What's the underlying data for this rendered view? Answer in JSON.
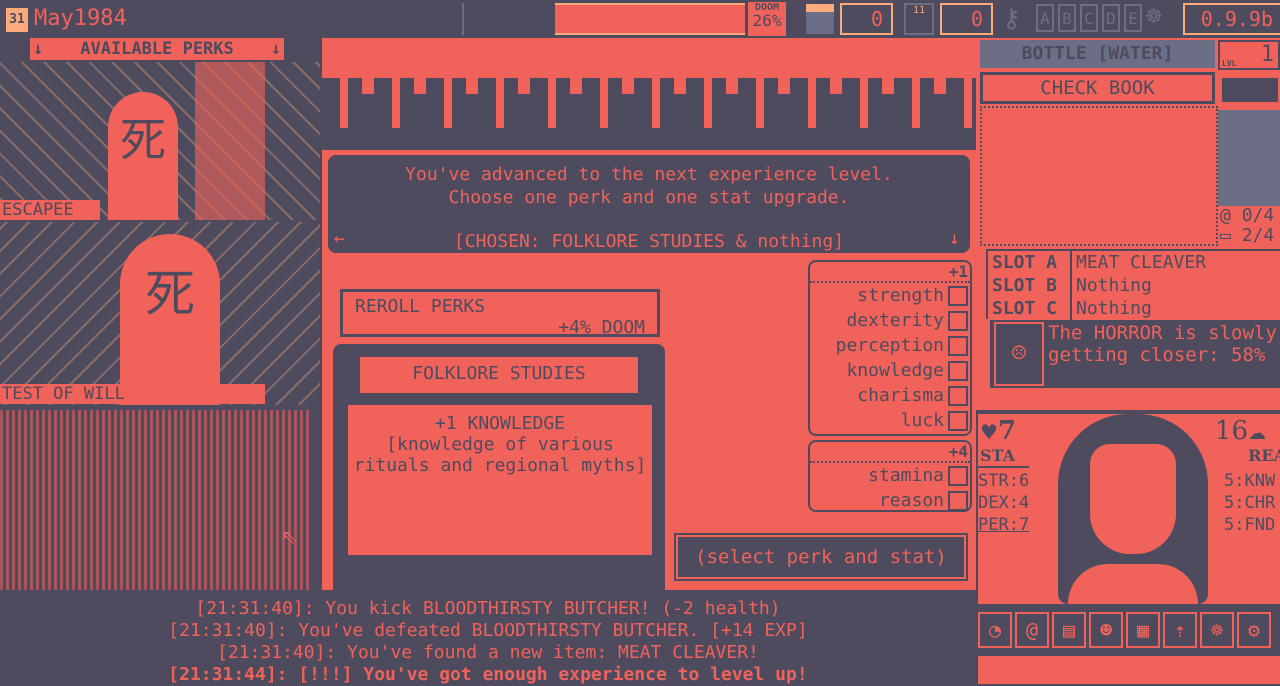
{
  "topbar": {
    "day": "31",
    "date": "May1984",
    "doom_label": "DOOM",
    "doom_value": "26%",
    "ammo": "0",
    "saves": "0",
    "floppy_num": "11",
    "letters": [
      "A",
      "B",
      "C",
      "D",
      "E"
    ],
    "version": "0.9.9b",
    "icons": [
      "calendar-icon",
      "bullets-icon",
      "floppy-icon",
      "key-icon",
      "octopus-icon"
    ]
  },
  "perks": {
    "header": "AVAILABLE PERKS",
    "items": [
      {
        "name": "ESCAPEE",
        "glyph": "死"
      },
      {
        "name": "TEST OF WILL",
        "glyph": "死"
      }
    ]
  },
  "dialog": {
    "line1": "You've advanced to the next experience level.",
    "line2": "Choose one perk and one stat upgrade.",
    "chosen": "[CHOSEN: FOLKLORE STUDIES & nothing]"
  },
  "reroll": {
    "label": "REROLL PERKS",
    "cost": "+4% DOOM"
  },
  "perk_detail": {
    "title": "FOLKLORE STUDIES",
    "effect": "+1 KNOWLEDGE",
    "desc1": "[knowledge of various",
    "desc2": "rituals and regional myths]"
  },
  "stats": {
    "plus1_label": "+1",
    "plus1": [
      "strength",
      "dexterity",
      "perception",
      "knowledge",
      "charisma",
      "luck"
    ],
    "plus4_label": "+4",
    "plus4": [
      "stamina",
      "reason"
    ]
  },
  "confirm_button": "(select perk and stat)",
  "log": [
    {
      "text": "[21:31:40]: You kick BLOODTHIRSTY BUTCHER! (-2 health)",
      "bold": false
    },
    {
      "text": "[21:31:40]: You've defeated BLOODTHIRSTY BUTCHER. [+14 EXP]",
      "bold": false
    },
    {
      "text": "[21:31:40]: You've found a new item: MEAT CLEAVER!",
      "bold": false
    },
    {
      "text": "[21:31:44]: [!!!] You've got enough experience to level up!",
      "bold": true
    }
  ],
  "right": {
    "item": "BOTTLE [WATER]",
    "lvl_label": "LVL",
    "lvl": "1",
    "check_book": "CHECK BOOK",
    "spells": "0/4",
    "inventory": "2/4",
    "slots": [
      {
        "label": "SLOT A",
        "value": "MEAT CLEAVER"
      },
      {
        "label": "SLOT B",
        "value": "Nothing"
      },
      {
        "label": "SLOT C",
        "value": "Nothing"
      }
    ],
    "horror1": "The HORROR is slowly",
    "horror2": "getting closer: 58%"
  },
  "character": {
    "stamina": "7",
    "sta_label": "STA",
    "reason": "16",
    "rea_label": "REA",
    "left_stats": [
      "STR:6",
      "DEX:4",
      "PER:7"
    ],
    "right_stats": [
      "5:KNW",
      "5:CHR",
      "5:FND"
    ]
  },
  "menu_icons": [
    "clock-icon",
    "spiral-icon",
    "chart-icon",
    "people-icon",
    "building-icon",
    "level-up-icon",
    "octopus-icon",
    "gear-icon"
  ],
  "colors": {
    "dark": "#4f4b5e",
    "red": "#f0625a",
    "peach": "#fcaa7c"
  }
}
